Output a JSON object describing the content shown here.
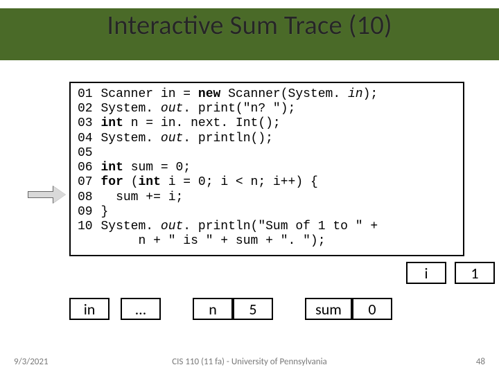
{
  "title": "Interactive Sum Trace (10)",
  "code": {
    "lines": [
      {
        "n": "01",
        "text": "Scanner in = new Scanner(System. in);",
        "html": "Scanner in = <span class='kw'>new</span> Scanner(System. <span class='field'>in</span>);"
      },
      {
        "n": "02",
        "text": "System. out. print(\"n? \");",
        "html": "System. <span class='field'>out</span>. print(\"n? \");"
      },
      {
        "n": "03",
        "text": "int n = in. next. Int();",
        "html": "<span class='kw'>int</span> n = in. next. Int();"
      },
      {
        "n": "04",
        "text": "System. out. println();",
        "html": "System. <span class='field'>out</span>. println();"
      },
      {
        "n": "05",
        "text": "",
        "html": ""
      },
      {
        "n": "06",
        "text": "int sum = 0;",
        "html": "<span class='kw'>int</span> sum = 0;"
      },
      {
        "n": "07",
        "text": "for (int i = 0; i < n; i++) {",
        "html": "<span class='kw'>for</span> (<span class='kw'>int</span> i = 0; i &lt; n; i++) {"
      },
      {
        "n": "08",
        "text": "  sum += i;",
        "html": "&nbsp;&nbsp;sum += i;"
      },
      {
        "n": "09",
        "text": "}",
        "html": "}"
      },
      {
        "n": "10",
        "text": "System. out. println(\"Sum of 1 to \" +",
        "html": "System. <span class='field'>out</span>. println(\"Sum of 1 to \" +"
      },
      {
        "n": "",
        "text": "     n + \" is \" + sum + \". \");",
        "html": "&nbsp;&nbsp;&nbsp;&nbsp;&nbsp;n + \" is \" + sum + \". \");"
      }
    ]
  },
  "vars": {
    "in_label": "in",
    "in_value": "…",
    "n_label": "n",
    "n_value": "5",
    "sum_label": "sum",
    "sum_value": "0",
    "i_label": "i",
    "i_value": "1"
  },
  "footer": {
    "date": "9/3/2021",
    "center": "CIS 110 (11 fa) - University of Pennsylvania",
    "page": "48"
  }
}
